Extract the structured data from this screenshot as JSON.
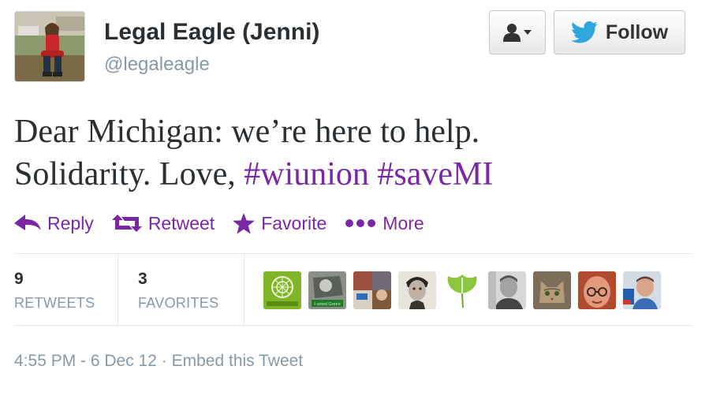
{
  "user": {
    "display_name": "Legal Eagle (Jenni)",
    "screen_name": "@legaleagle",
    "avatar_icon": "profile-photo"
  },
  "buttons": {
    "user_dropdown_icon": "user-person-icon",
    "follow_label": "Follow",
    "follow_icon": "twitter-bird-icon"
  },
  "tweet": {
    "line1": "Dear Michigan: we’re here to help.",
    "line2_text": "Solidarity. Love,",
    "hashtags": [
      "#wiunion",
      "#saveMI"
    ]
  },
  "actions": [
    {
      "label": "Reply",
      "icon": "reply-arrow-icon"
    },
    {
      "label": "Retweet",
      "icon": "retweet-icon"
    },
    {
      "label": "Favorite",
      "icon": "star-icon"
    },
    {
      "label": "More",
      "icon": "more-dots-icon"
    }
  ],
  "stats": {
    "retweets": {
      "count": "9",
      "label": "RETWEETS"
    },
    "favorites": {
      "count": "3",
      "label": "FAVORITES"
    }
  },
  "favoriters": {
    "count": 9,
    "badge_text": "I voted Green"
  },
  "metadata": {
    "timestamp": "4:55 PM - 6 Dec 12",
    "separator": "·",
    "embed_label": "Embed this Tweet"
  },
  "colors": {
    "accent": "#7a27a6",
    "twitter_blue": "#2ea7e0",
    "muted": "#8899a6",
    "text": "#292f33"
  }
}
